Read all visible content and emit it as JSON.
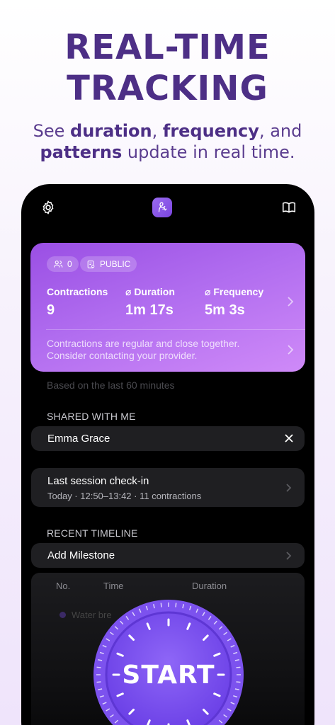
{
  "hero": {
    "title_line1": "REAL-TIME",
    "title_line2": "TRACKING",
    "sub_1": "See ",
    "sub_b1": "duration",
    "sub_2": ", ",
    "sub_b2": "frequency",
    "sub_3": ", and",
    "sub_b3": "patterns",
    "sub_4": " update in real time."
  },
  "topbar": {
    "settings_icon": "gear-icon",
    "app_icon": "app-logo-icon",
    "book_icon": "book-icon"
  },
  "summary_card": {
    "followers_count": "0",
    "visibility": "PUBLIC",
    "stats": [
      {
        "label": "Contractions",
        "value": "9"
      },
      {
        "label": "⌀ Duration",
        "value": "1m 17s"
      },
      {
        "label": "⌀ Frequency",
        "value": "5m 3s"
      }
    ],
    "note": "Contractions are regular and close together. Consider contacting your provider."
  },
  "based_on": "Based on the last 60 minutes",
  "shared": {
    "heading": "SHARED WITH ME",
    "person": "Emma Grace"
  },
  "last_session": {
    "title": "Last session check-in",
    "detail": "Today · 12:50–13:42 · 11 contractions"
  },
  "timeline": {
    "heading": "RECENT TIMELINE",
    "add_milestone": "Add Milestone",
    "columns": [
      "No.",
      "Time",
      "Duration"
    ],
    "faded_row": "Water bre"
  },
  "start_button": {
    "label": "START",
    "accent": "#7b4ff0"
  }
}
